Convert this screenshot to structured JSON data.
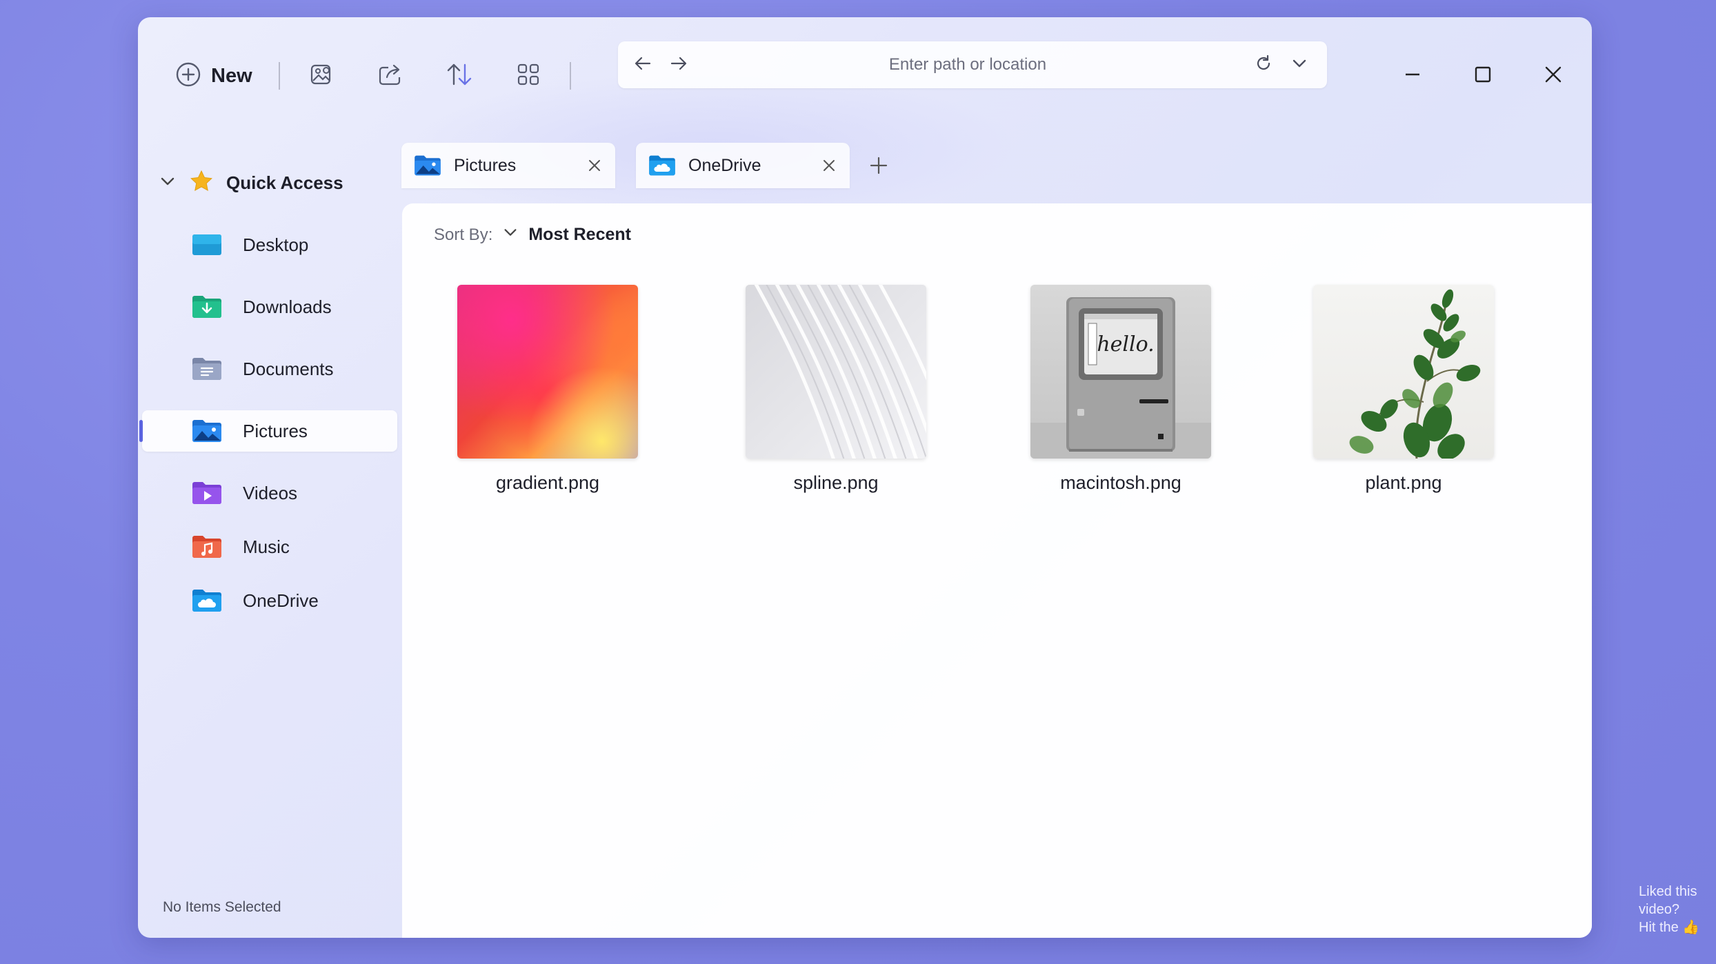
{
  "toolbar": {
    "new_label": "New",
    "icons": [
      "plus-circle-icon",
      "image-edit-icon",
      "share-icon",
      "sort-icon",
      "grid-view-icon"
    ]
  },
  "address_bar": {
    "placeholder": "Enter path or location"
  },
  "sidebar": {
    "quick_access": "Quick Access",
    "items": [
      {
        "label": "Desktop",
        "icon": "desktop-folder-icon"
      },
      {
        "label": "Downloads",
        "icon": "downloads-folder-icon"
      },
      {
        "label": "Documents",
        "icon": "documents-folder-icon"
      },
      {
        "label": "Pictures",
        "icon": "pictures-folder-icon",
        "active": true
      },
      {
        "label": "Videos",
        "icon": "videos-folder-icon"
      },
      {
        "label": "Music",
        "icon": "music-folder-icon"
      },
      {
        "label": "OneDrive",
        "icon": "onedrive-folder-icon"
      }
    ],
    "status": "No Items Selected"
  },
  "tabs": [
    {
      "label": "Pictures",
      "icon": "pictures-folder-icon"
    },
    {
      "label": "OneDrive",
      "icon": "onedrive-folder-icon"
    }
  ],
  "sort": {
    "label": "Sort By:",
    "value": "Most Recent"
  },
  "files": [
    {
      "name": "gradient.png"
    },
    {
      "name": "spline.png"
    },
    {
      "name": "macintosh.png",
      "screen_text": "hello."
    },
    {
      "name": "plant.png"
    }
  ],
  "watermark": {
    "line1": "Liked this",
    "line2": "video?",
    "line3": "Hit the"
  }
}
